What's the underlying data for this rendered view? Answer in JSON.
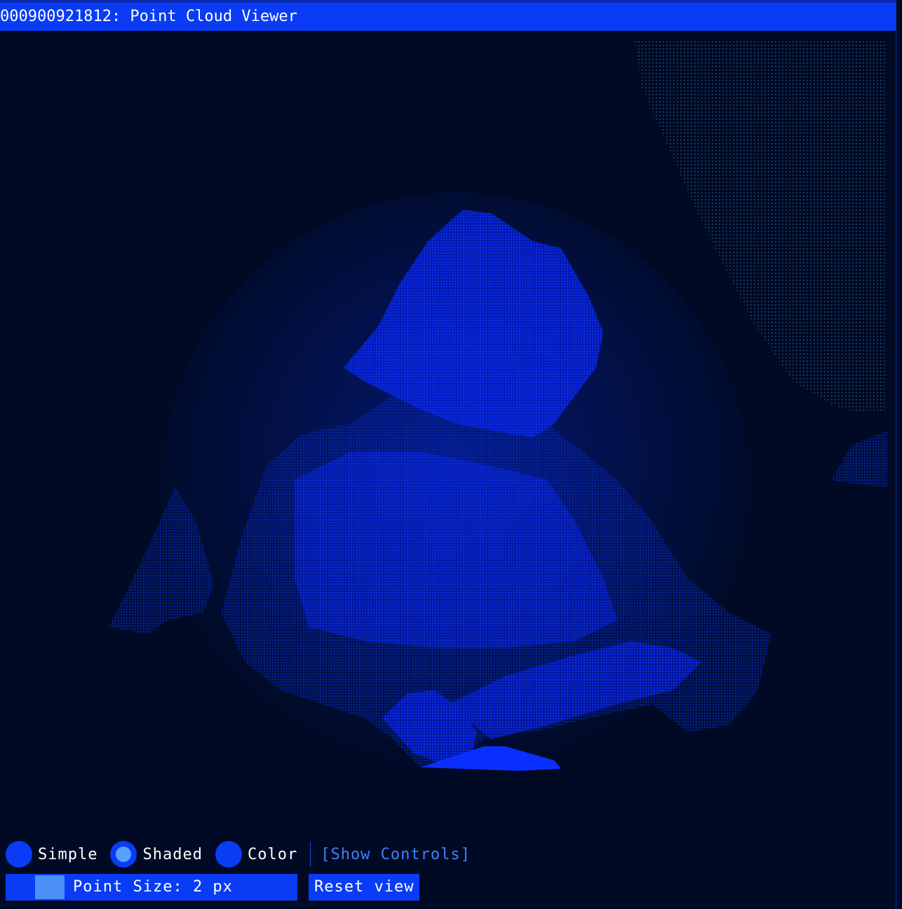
{
  "window": {
    "title": "000900921812: Point Cloud Viewer"
  },
  "render_modes": [
    {
      "label": "Simple",
      "selected": false
    },
    {
      "label": "Shaded",
      "selected": true
    },
    {
      "label": "Color",
      "selected": false
    }
  ],
  "controls": {
    "show_controls_label": "[Show Controls]",
    "point_size_label": "Point Size: 2 px",
    "reset_view_label": "Reset view"
  },
  "colors": {
    "accent": "#0a3cf5",
    "background": "#000a24",
    "point_cloud": "#0a28ff",
    "background_points": "#2a5a90"
  }
}
